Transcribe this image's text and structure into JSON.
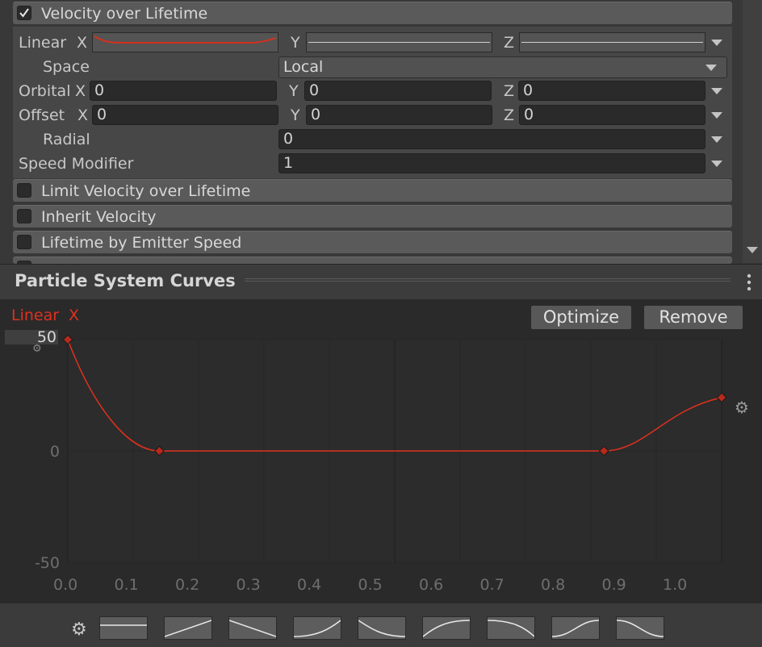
{
  "module": {
    "title": "Velocity over Lifetime",
    "enabled": true,
    "linear": {
      "label": "Linear",
      "x": "X",
      "y": "Y",
      "z": "Z"
    },
    "space": {
      "label": "Space",
      "value": "Local"
    },
    "orbital": {
      "label": "Orbital",
      "x_axis": "X",
      "x": "0",
      "y_axis": "Y",
      "y": "0",
      "z_axis": "Z",
      "z": "0"
    },
    "offset": {
      "label": "Offset",
      "x_axis": "X",
      "x": "0",
      "y_axis": "Y",
      "y": "0",
      "z_axis": "Z",
      "z": "0"
    },
    "radial": {
      "label": "Radial",
      "value": "0"
    },
    "speed_modifier": {
      "label": "Speed Modifier",
      "value": "1"
    }
  },
  "other_modules": [
    {
      "title": "Limit Velocity over Lifetime",
      "enabled": false
    },
    {
      "title": "Inherit Velocity",
      "enabled": false
    },
    {
      "title": "Lifetime by Emitter Speed",
      "enabled": false
    }
  ],
  "curves_window": {
    "title": "Particle System Curves",
    "curve_name": "Linear",
    "curve_axis": "X",
    "max_field": "50",
    "optimize_label": "Optimize",
    "remove_label": "Remove",
    "y_ticks": [
      "0",
      "-50"
    ],
    "x_ticks": [
      "0.0",
      "0.1",
      "0.2",
      "0.3",
      "0.4",
      "0.5",
      "0.6",
      "0.7",
      "0.8",
      "0.9",
      "1.0"
    ],
    "curve_color": "#e0301e"
  },
  "chart_data": {
    "type": "line",
    "title": "",
    "xlabel": "",
    "ylabel": "",
    "xlim": [
      0.0,
      1.0
    ],
    "ylim": [
      -50,
      50
    ],
    "series": [
      {
        "name": "Linear X",
        "points": [
          [
            0.0,
            50
          ],
          [
            0.14,
            0
          ],
          [
            0.82,
            0
          ],
          [
            1.0,
            24
          ]
        ]
      }
    ]
  }
}
